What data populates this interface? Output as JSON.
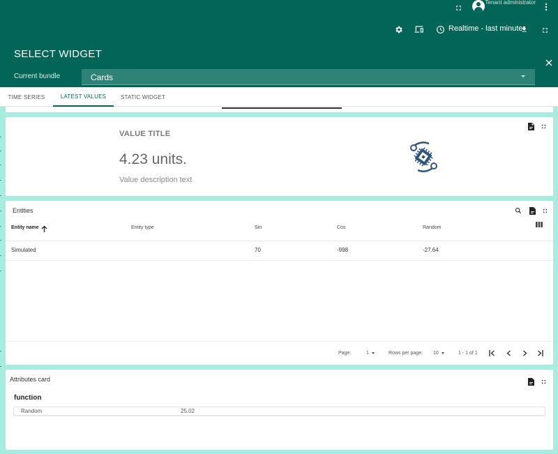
{
  "header": {
    "tenant_label": "Tenant administrator",
    "timewindow_label": "Realtime - last minute"
  },
  "select_widget": {
    "title": "SELECT WIDGET",
    "bundle_label": "Current bundle",
    "bundle_value": "Cards"
  },
  "tabs": [
    {
      "label": "TIME SERIES"
    },
    {
      "label": "LATEST VALUES"
    },
    {
      "label": "STATIC WIDGET"
    }
  ],
  "value_card": {
    "title": "VALUE TITLE",
    "value": "4.23 units.",
    "description": "Value description text"
  },
  "entities_card": {
    "title": "Entities",
    "columns": [
      "Entity name",
      "Entity type",
      "Sin",
      "Cos",
      "Random"
    ],
    "rows": [
      [
        "Simulated",
        "",
        "70",
        "-998",
        "-27.64"
      ]
    ],
    "footer": {
      "page_label": "Page:",
      "page_value": "1",
      "rows_label": "Rows per page:",
      "rows_value": "10",
      "range": "1 - 1 of 1"
    }
  },
  "attributes_card": {
    "title": "Attributes card",
    "subtitle": "function",
    "rows": [
      {
        "key": "Random",
        "value": "25.02"
      }
    ]
  },
  "colors": {
    "primary": "#036557",
    "background": "#a6ede0",
    "icon_blue": "#305680"
  }
}
